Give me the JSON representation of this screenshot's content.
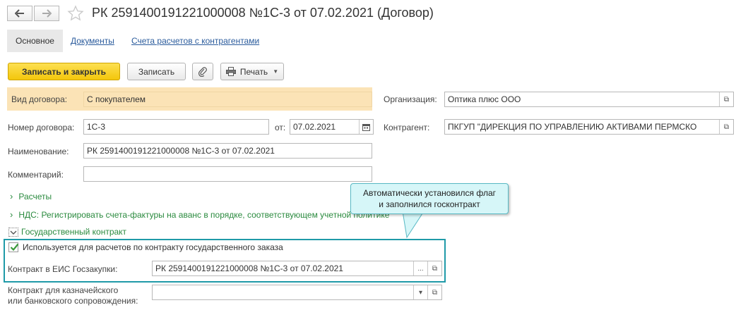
{
  "window": {
    "title": "РК 2591400191221000008 №1С-3 от 07.02.2021 (Договор)"
  },
  "tabs": [
    {
      "label": "Основное"
    },
    {
      "label": "Документы"
    },
    {
      "label": "Счета расчетов с контрагентами"
    }
  ],
  "toolbar": {
    "save_close_label": "Записать и закрыть",
    "save_label": "Записать",
    "print_label": "Печать"
  },
  "form": {
    "contract_type": {
      "label": "Вид договора:",
      "value": "С покупателем"
    },
    "organization": {
      "label": "Организация:",
      "value": "Оптика плюс ООО"
    },
    "contract_number": {
      "label": "Номер договора:",
      "value": "1С-3"
    },
    "date": {
      "label": "от:",
      "value": "07.02.2021"
    },
    "counterparty": {
      "label": "Контрагент:",
      "value": "ПКГУП \"ДИРЕКЦИЯ ПО УПРАВЛЕНИЮ АКТИВАМИ ПЕРМСКО"
    },
    "name": {
      "label": "Наименование:",
      "value": "РК 2591400191221000008 №1С-3 от 07.02.2021"
    },
    "comment": {
      "label": "Комментарий:",
      "value": ""
    }
  },
  "sections": {
    "settlements": "Расчеты",
    "vat": "НДС: Регистрировать счета-фактуры на аванс в порядке, соответствующем учетной политике",
    "gov_contract": "Государственный контракт"
  },
  "gov": {
    "checkbox_label": "Используется для расчетов по контракту государственного заказа",
    "checkbox_checked": true,
    "eis_label": "Контракт в ЕИС Госзакупки:",
    "eis_value": "РК 2591400191221000008 №1С-3 от 07.02.2021",
    "treasury_label_line1": "Контракт для казначейского",
    "treasury_label_line2": "или банковского сопровождения:",
    "treasury_value": ""
  },
  "tooltip": {
    "line1": "Автоматически установился флаг",
    "line2": "и заполнился госконтракт"
  },
  "colors": {
    "primary_button": "#f3c60b",
    "highlight_row": "#fbe3b6",
    "green_link": "#2a8a3e",
    "frame": "#1f9aa8",
    "tooltip_bg": "#d6f6f8"
  }
}
